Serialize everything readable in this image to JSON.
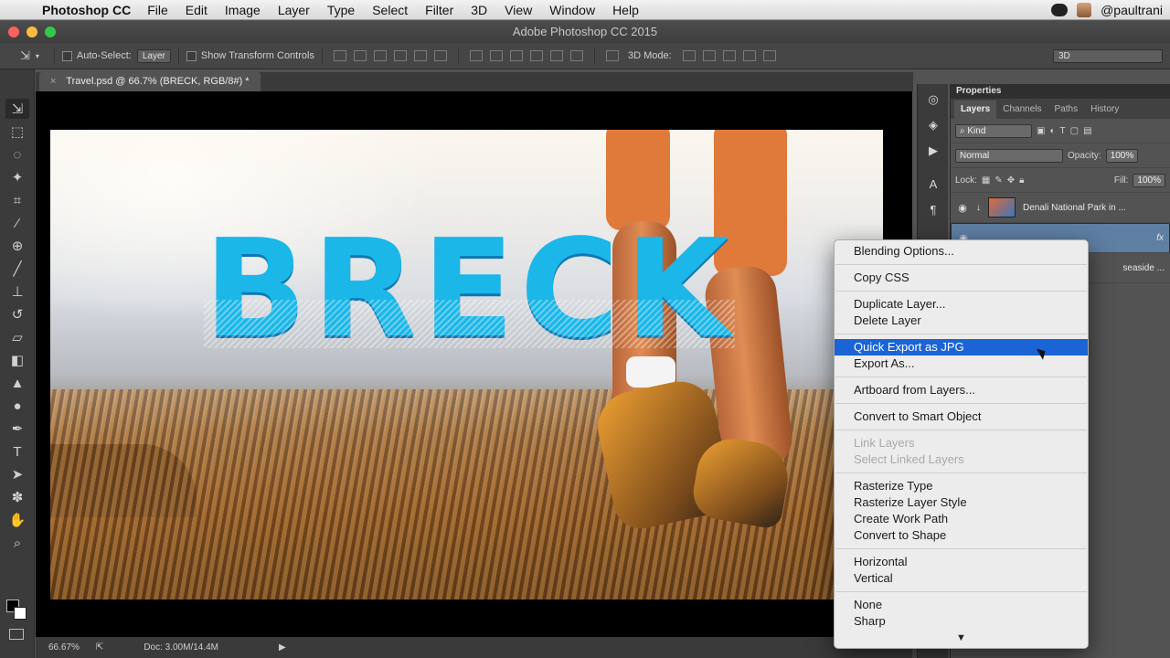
{
  "menubar": {
    "app_name": "Photoshop CC",
    "items": [
      "File",
      "Edit",
      "Image",
      "Layer",
      "Type",
      "Select",
      "Filter",
      "3D",
      "View",
      "Window",
      "Help"
    ],
    "username": "@paultrani"
  },
  "window": {
    "title": "Adobe Photoshop CC 2015"
  },
  "options_bar": {
    "auto_select_label": "Auto-Select:",
    "auto_select_value": "Layer",
    "show_transform_label": "Show Transform Controls",
    "mode_3d_label": "3D Mode:",
    "workspace_value": "3D"
  },
  "document": {
    "tab_title": "Travel.psd @ 66.7% (BRECK, RGB/8#) *",
    "canvas_text": "BRECK"
  },
  "status": {
    "zoom": "66.67%",
    "doc_size": "Doc: 3.00M/14.4M"
  },
  "panels": {
    "properties_title": "Properties",
    "tabs": [
      "Layers",
      "Channels",
      "Paths",
      "History"
    ],
    "filter_kind": "Kind",
    "blend_mode": "Normal",
    "opacity_label": "Opacity:",
    "opacity_value": "100%",
    "lock_label": "Lock:",
    "fill_label": "Fill:",
    "fill_value": "100%",
    "layers": [
      {
        "name": "Denali National Park in ..."
      },
      {
        "name": "",
        "fx": "fx"
      },
      {
        "name": "seaside ..."
      }
    ]
  },
  "context_menu": {
    "groups": [
      [
        "Blending Options..."
      ],
      [
        "Copy CSS"
      ],
      [
        "Duplicate Layer...",
        "Delete Layer"
      ],
      [
        "Quick Export as JPG",
        "Export As..."
      ],
      [
        "Artboard from Layers..."
      ],
      [
        "Convert to Smart Object"
      ],
      [
        "Link Layers",
        "Select Linked Layers"
      ],
      [
        "Rasterize Type",
        "Rasterize Layer Style",
        "Create Work Path",
        "Convert to Shape"
      ],
      [
        "Horizontal",
        "Vertical"
      ],
      [
        "None",
        "Sharp"
      ]
    ],
    "highlighted": "Quick Export as JPG",
    "disabled": [
      "Link Layers",
      "Select Linked Layers"
    ],
    "scroll_arrow": "▼"
  },
  "colors": {
    "accent": "#1a64d6",
    "text_fill": "#1bb7e8",
    "chrome": "#535353"
  }
}
